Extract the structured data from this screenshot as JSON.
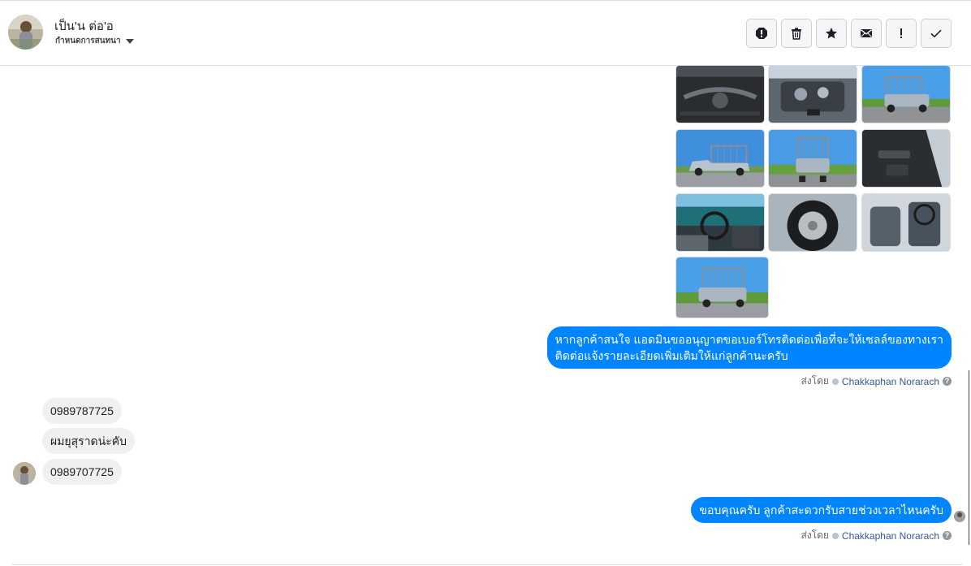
{
  "header": {
    "contact_name": "เป็น'น ต่อ'อ",
    "assign_label": "กำหนดการสนทนา",
    "actions": [
      "spam-icon",
      "trash-icon",
      "star-icon",
      "envelope-icon",
      "exclamation-icon",
      "check-icon"
    ]
  },
  "messages": {
    "outgoing_1_line1": "หากลูกค้าสนใจ แอดมินขออนุญาตขอเบอร์โทรติดต่อเพื่อที่จะให้เซลล์ของทางเรา",
    "outgoing_1_line2": "ติดต่อแจ้งรายละเอียดเพิ่มเติมให้แก่ลูกค้านะครับ",
    "incoming": [
      "0989787725",
      "ผมยุสุราดน่ะคับ",
      "0989707725"
    ],
    "outgoing_2": "ขอบคุณครับ ลูกค้าสะดวกรับสายช่วงเวลาไหนครับ"
  },
  "sent_by": {
    "prefix": "ส่งโดย",
    "sender": "Chakkaphan Norarach",
    "help": "?"
  },
  "photos": [
    "truck-undercarriage-photo",
    "engine-bay-photo",
    "pickup-with-cage-rear-photo",
    "pickup-side-photo",
    "pickup-rear-photo",
    "door-interior-photo",
    "dashboard-photo",
    "wheel-photo",
    "seats-interior-photo",
    "pickup-rear-quarter-photo"
  ]
}
